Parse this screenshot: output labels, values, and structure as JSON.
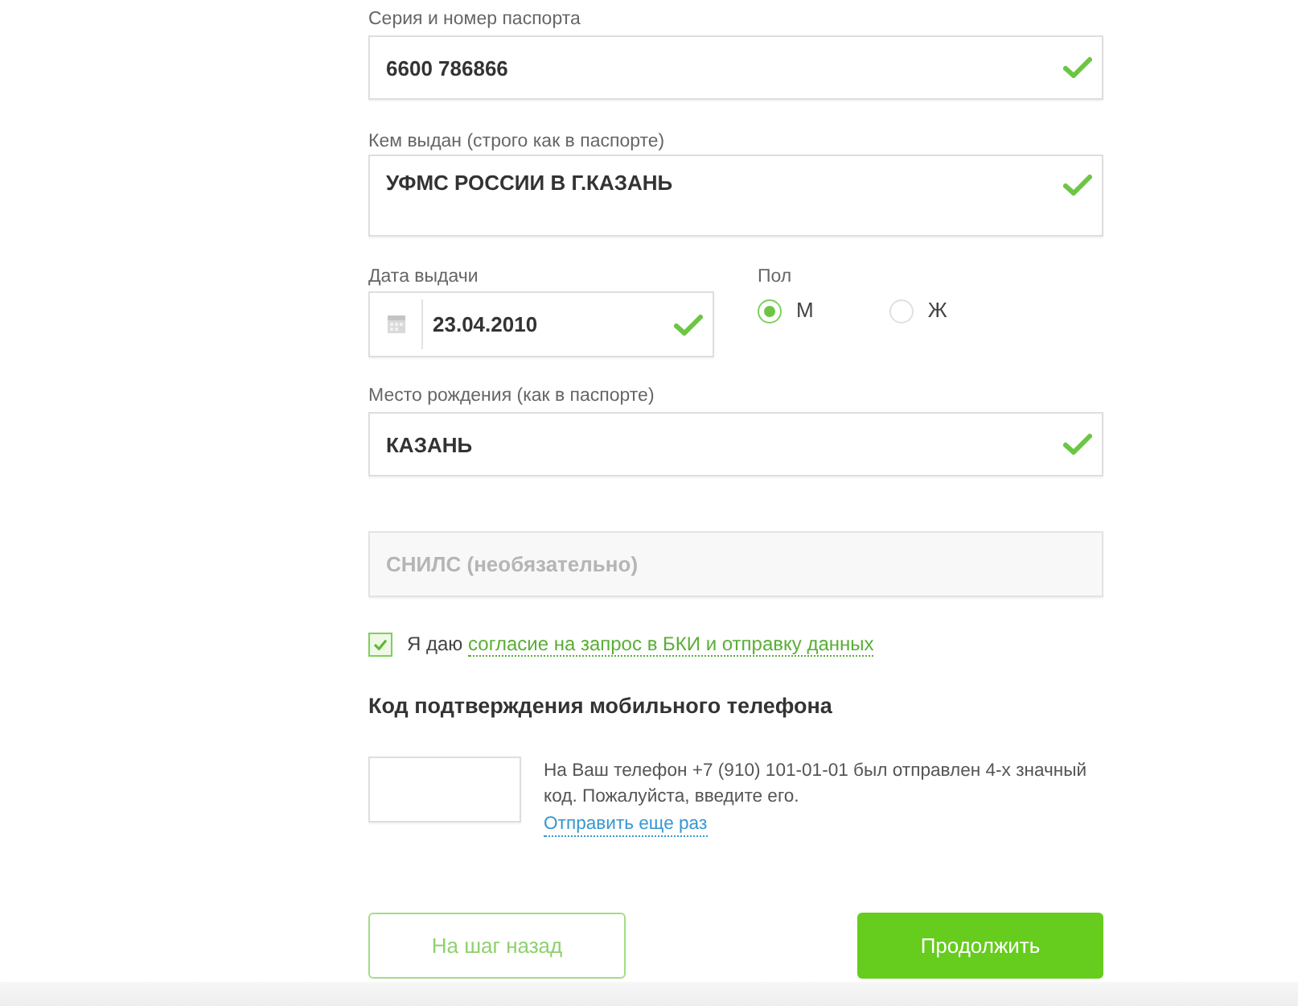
{
  "passport_number": {
    "label": "Серия и номер паспорта",
    "value": "6600 786866",
    "valid": true
  },
  "issued_by": {
    "label": "Кем выдан (строго как в паспорте)",
    "value": "УФМС РОССИИ В Г.КАЗАНЬ",
    "valid": true
  },
  "issue_date": {
    "label": "Дата выдачи",
    "value": "23.04.2010",
    "valid": true
  },
  "gender": {
    "label": "Пол",
    "options": [
      {
        "label": "М",
        "selected": true
      },
      {
        "label": "Ж",
        "selected": false
      }
    ]
  },
  "birthplace": {
    "label": "Место рождения (как в паспорте)",
    "value": "КАЗАНЬ",
    "valid": true
  },
  "snils": {
    "placeholder": "СНИЛС (необязательно)"
  },
  "consent": {
    "checked": true,
    "text": "Я даю",
    "link": "согласие на запрос в БКИ и отправку данных"
  },
  "sms_confirmation": {
    "title": "Код подтверждения мобильного телефона",
    "message": "На Ваш телефон +7 (910) 101-01-01 был отправлен 4-х значный код. Пожалуйста, введите его.",
    "resend_link": "Отправить еще раз"
  },
  "buttons": [
    {
      "kind": "secondary",
      "label": "На шаг назад"
    },
    {
      "kind": "primary",
      "label": "Продолжить"
    }
  ]
}
